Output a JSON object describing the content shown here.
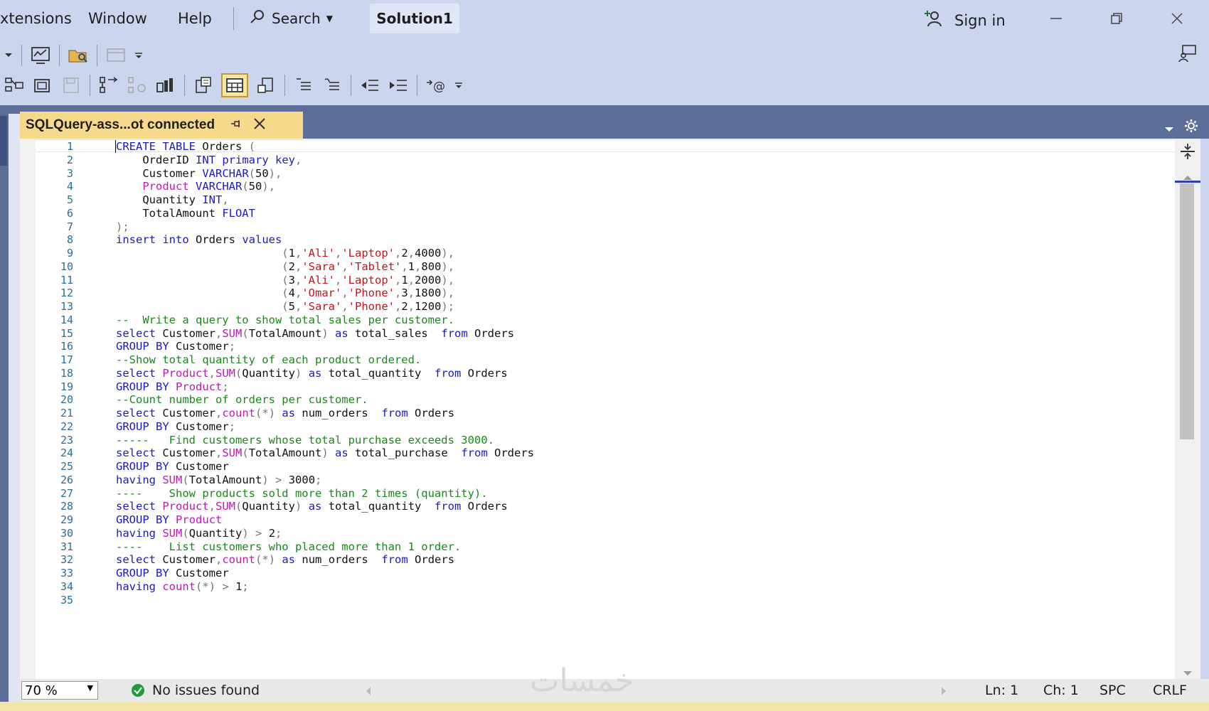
{
  "menu": {
    "extensions": "xtensions",
    "window": "Window",
    "help": "Help",
    "search": "Search",
    "solution": "Solution1",
    "sign_in": "Sign in"
  },
  "tab": {
    "title": "SQLQuery-ass...ot connected"
  },
  "editor": {
    "line_numbers": [
      "1",
      "2",
      "3",
      "4",
      "5",
      "6",
      "7",
      "8",
      "9",
      "10",
      "11",
      "12",
      "13",
      "14",
      "15",
      "16",
      "17",
      "18",
      "19",
      "20",
      "21",
      "22",
      "23",
      "24",
      "25",
      "26",
      "27",
      "28",
      "29",
      "30",
      "31",
      "32",
      "33",
      "34",
      "35"
    ],
    "lines": [
      "CREATE TABLE Orders (",
      "    OrderID INT primary key,",
      "    Customer VARCHAR(50),",
      "    Product VARCHAR(50),",
      "    Quantity INT,",
      "    TotalAmount FLOAT",
      ");",
      "insert into Orders values",
      "                         (1,'Ali','Laptop',2,4000),",
      "                         (2,'Sara','Tablet',1,800),",
      "                         (3,'Ali','Laptop',1,2000),",
      "                         (4,'Omar','Phone',3,1800),",
      "                         (5,'Sara','Phone',2,1200);",
      "--  Write a query to show total sales per customer.",
      "select Customer,SUM(TotalAmount) as total_sales  from Orders",
      "GROUP BY Customer;",
      "--Show total quantity of each product ordered.",
      "select Product,SUM(Quantity) as total_quantity  from Orders",
      "GROUP BY Product;",
      "--Count number of orders per customer.",
      "select Customer,count(*) as num_orders  from Orders",
      "GROUP BY Customer;",
      "-----   Find customers whose total purchase exceeds 3000.",
      "select Customer,SUM(TotalAmount) as total_purchase  from Orders",
      "GROUP BY Customer",
      "having SUM(TotalAmount) > 3000;",
      "----    Show products sold more than 2 times (quantity).",
      "select Product,SUM(Quantity) as total_quantity  from Orders",
      "GROUP BY Product",
      "having SUM(Quantity) > 2;",
      "----    List customers who placed more than 1 order.",
      "select Customer,count(*) as num_orders  from Orders",
      "GROUP BY Customer",
      "having count(*) > 1;",
      ""
    ]
  },
  "status": {
    "zoom": "70 %",
    "issues": "No issues found",
    "ln": "Ln: 1",
    "ch": "Ch: 1",
    "spc": "SPC",
    "crlf": "CRLF",
    "watermark": "خمسات"
  },
  "colors": {
    "keyword": "#1a1ac4",
    "function": "#c017b7",
    "string": "#c4141c",
    "comment": "#198a19",
    "tab_active": "#f6d98b",
    "tab_row": "#5c6d97"
  }
}
